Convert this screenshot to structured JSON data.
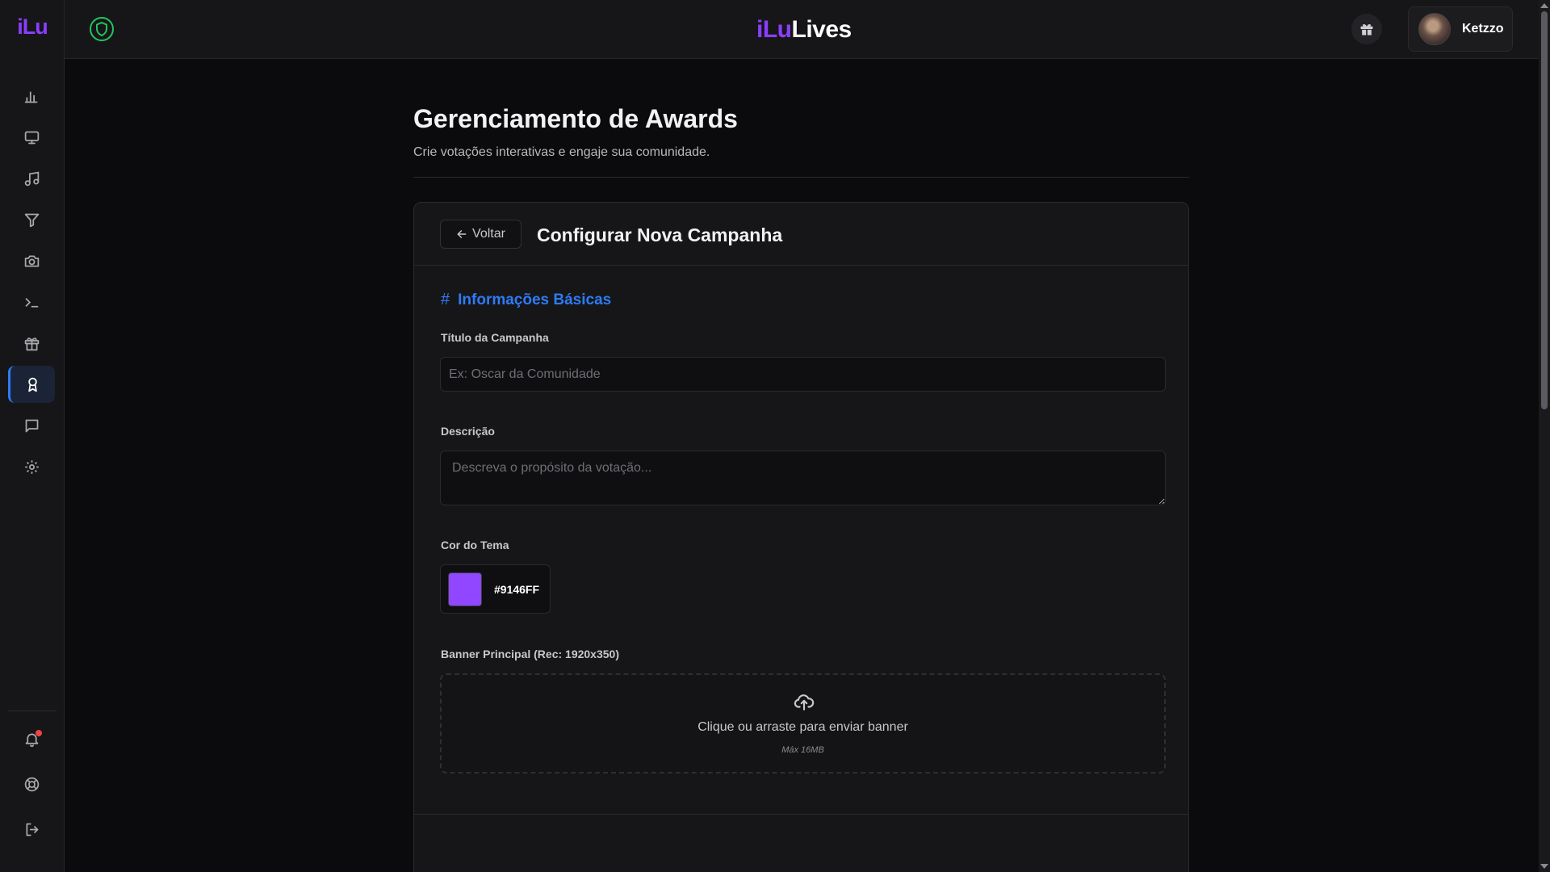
{
  "app": {
    "logo_small": "iLu",
    "brand_part1": "iLu",
    "brand_part2": "Lives"
  },
  "user": {
    "name": "Ketzzo"
  },
  "sidebar": {
    "items": [
      {
        "icon": "bar-chart-icon"
      },
      {
        "icon": "monitor-icon"
      },
      {
        "icon": "music-icon"
      },
      {
        "icon": "filter-icon"
      },
      {
        "icon": "camera-icon"
      },
      {
        "icon": "terminal-icon"
      },
      {
        "icon": "gift-icon"
      },
      {
        "icon": "award-icon",
        "active": true
      },
      {
        "icon": "message-icon"
      },
      {
        "icon": "settings-icon"
      }
    ],
    "bottom": [
      {
        "icon": "bell-icon",
        "has_notification": true
      },
      {
        "icon": "lifebuoy-icon"
      },
      {
        "icon": "logout-icon"
      }
    ]
  },
  "page": {
    "title": "Gerenciamento de Awards",
    "subtitle": "Crie votações interativas e engaje sua comunidade."
  },
  "card": {
    "back_label": "Voltar",
    "title": "Configurar Nova Campanha",
    "section_title": "Informações Básicas",
    "fields": {
      "title_label": "Título da Campanha",
      "title_placeholder": "Ex: Oscar da Comunidade",
      "description_label": "Descrição",
      "description_placeholder": "Descreva o propósito da votação...",
      "color_label": "Cor do Tema",
      "color_value": "#9146FF",
      "banner_label": "Banner Principal (Rec: 1920x350)",
      "banner_text": "Clique ou arraste para enviar banner",
      "banner_hint": "Máx 16MB"
    }
  },
  "colors": {
    "accent_purple": "#8b3dff",
    "accent_blue": "#2e7bf6",
    "shield_green": "#22c55e",
    "theme_swatch": "#9146FF"
  }
}
